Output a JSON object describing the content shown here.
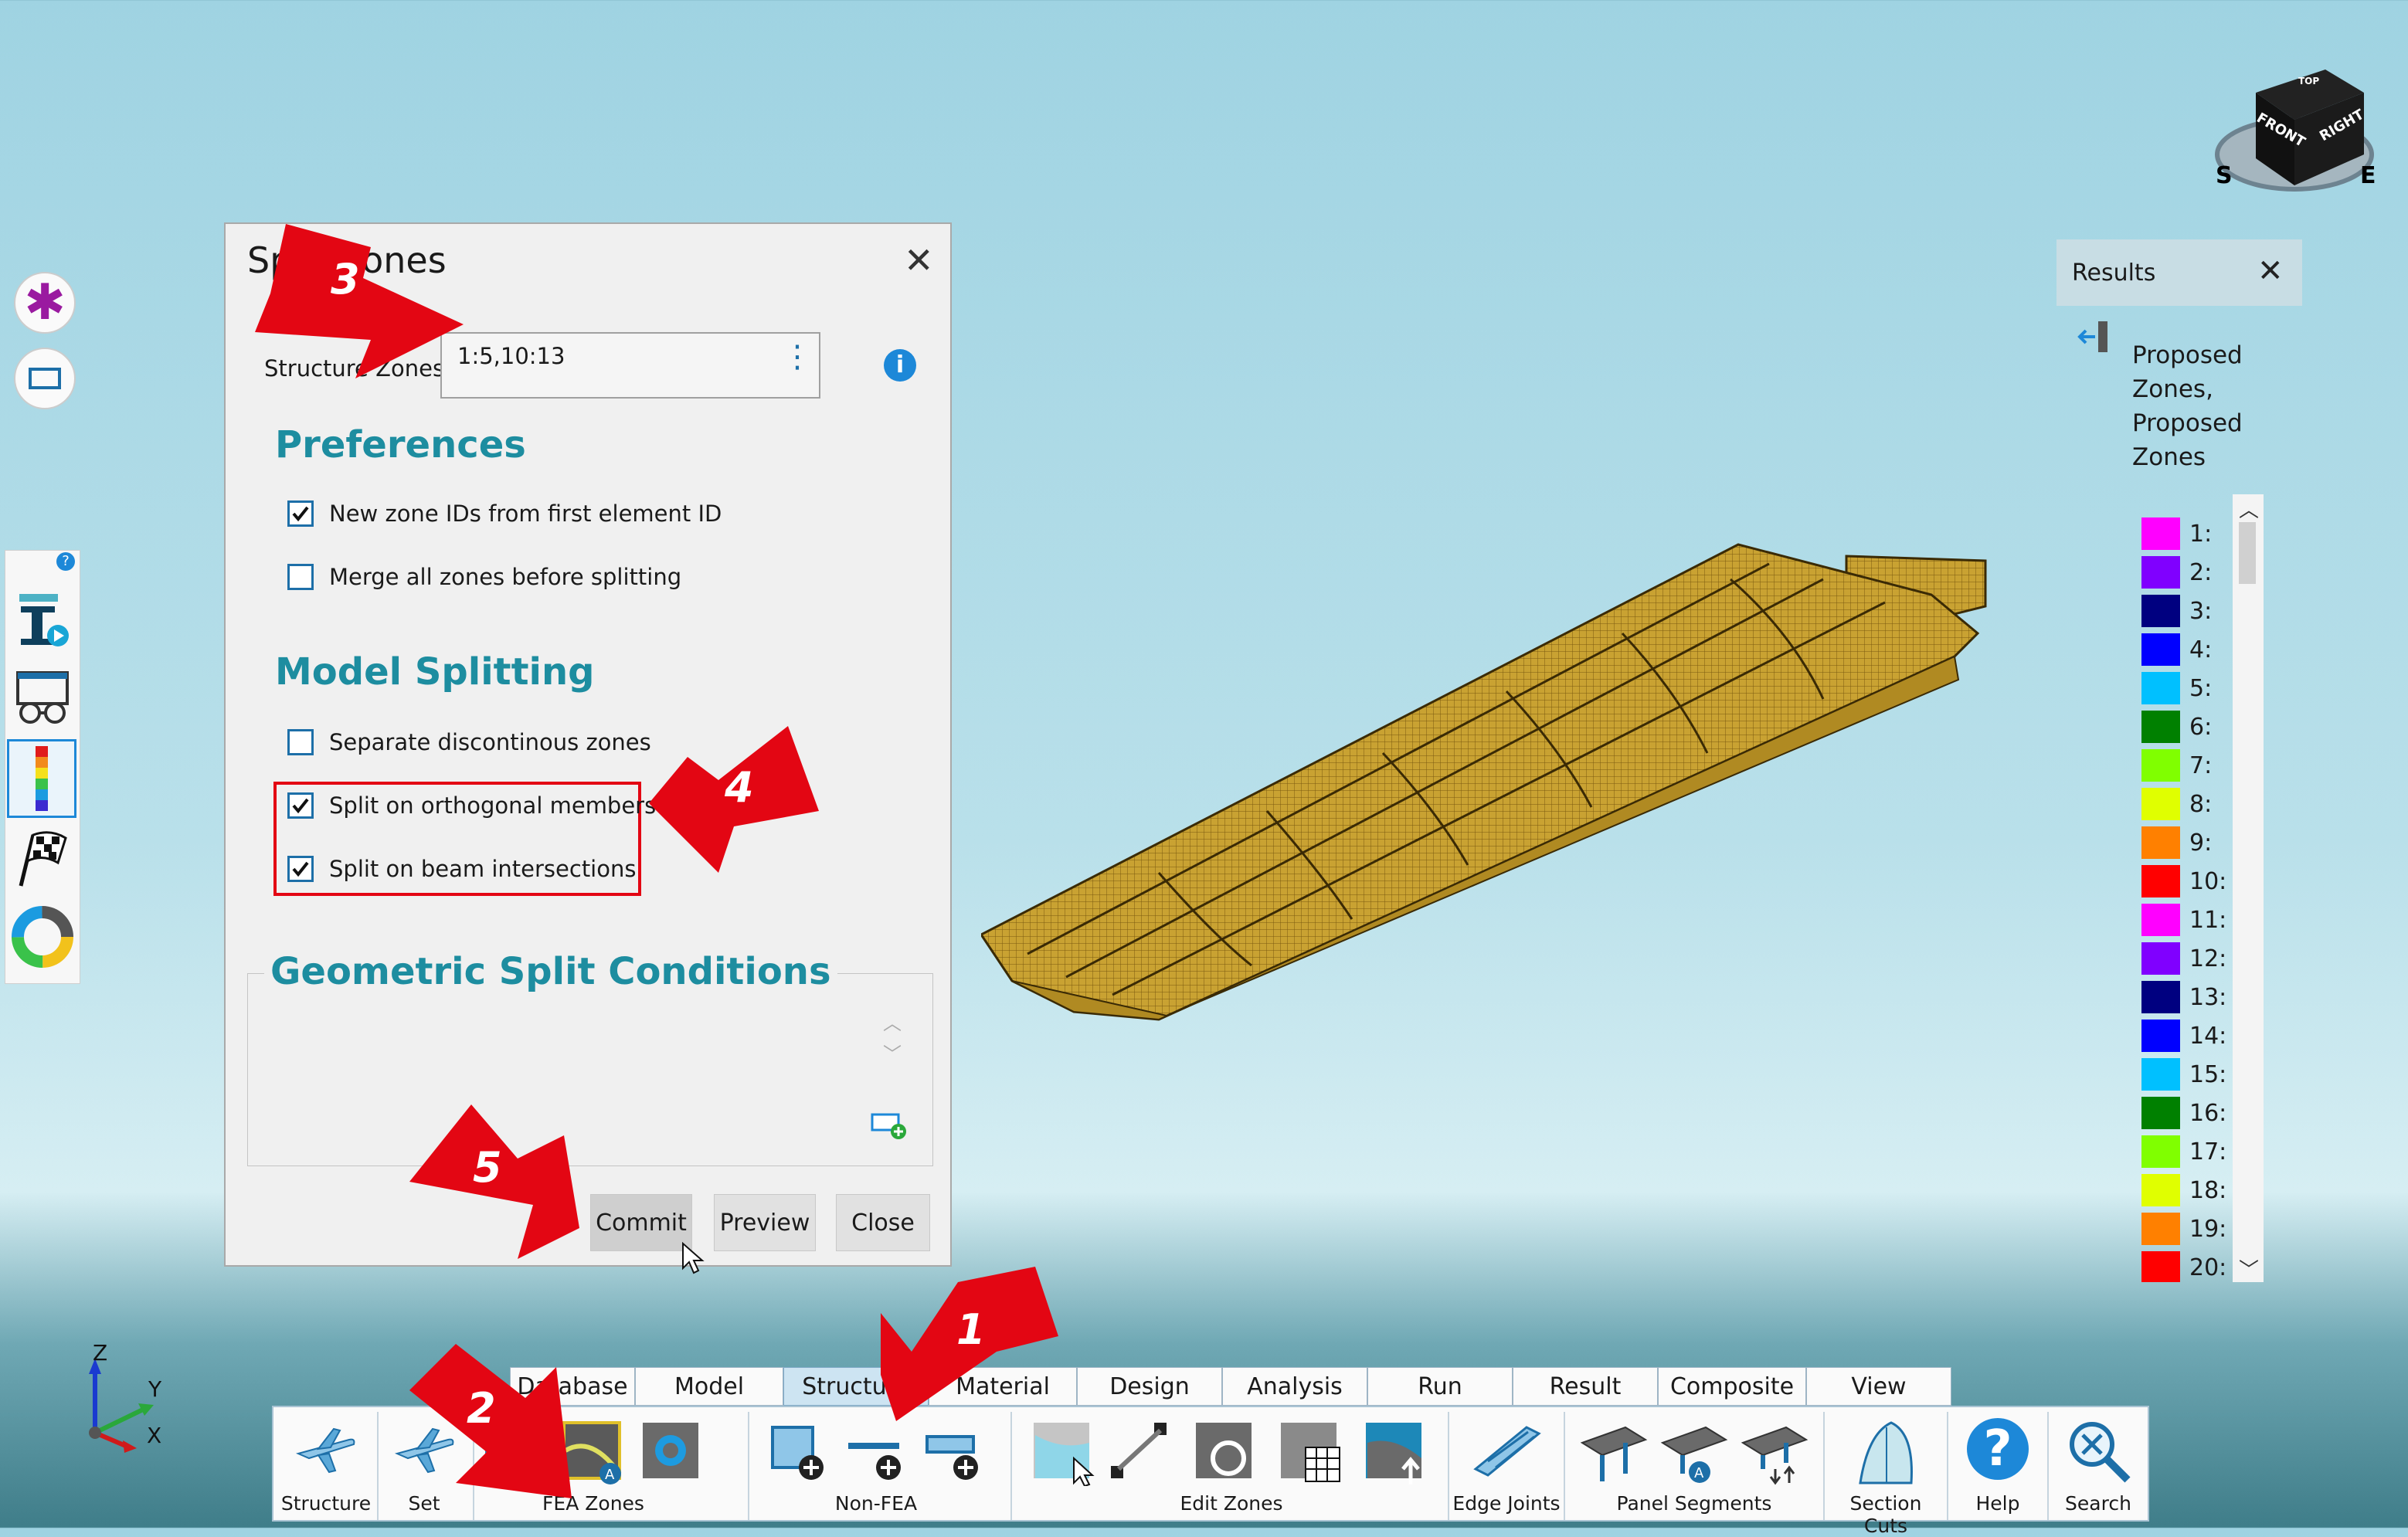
{
  "dialog": {
    "title": "Split Zones",
    "structure_zones_label": "Structure Zones:",
    "structure_zones_value": "1:5,10:13",
    "preferences_header": "Preferences",
    "pref_items": [
      {
        "label": "New zone IDs from first element ID",
        "checked": true
      },
      {
        "label": "Merge all zones before splitting",
        "checked": false
      }
    ],
    "model_splitting_header": "Model Splitting",
    "split_items": [
      {
        "label": "Separate discontinous zones",
        "checked": false
      },
      {
        "label": "Split on orthogonal members",
        "checked": true
      },
      {
        "label": "Split on beam intersections",
        "checked": true
      }
    ],
    "geometric_header": "Geometric Split Conditions",
    "buttons": {
      "commit": "Commit",
      "preview": "Preview",
      "close": "Close"
    }
  },
  "results_panel": {
    "title": "Results",
    "description": "Proposed Zones, Proposed Zones",
    "legend": [
      {
        "label": "1:",
        "color": "#ff00ff"
      },
      {
        "label": "2:",
        "color": "#8000ff"
      },
      {
        "label": "3:",
        "color": "#000080"
      },
      {
        "label": "4:",
        "color": "#0000ff"
      },
      {
        "label": "5:",
        "color": "#00c0ff"
      },
      {
        "label": "6:",
        "color": "#008000"
      },
      {
        "label": "7:",
        "color": "#80ff00"
      },
      {
        "label": "8:",
        "color": "#e0ff00"
      },
      {
        "label": "9:",
        "color": "#ff8000"
      },
      {
        "label": "10:",
        "color": "#ff0000"
      },
      {
        "label": "11:",
        "color": "#ff00ff"
      },
      {
        "label": "12:",
        "color": "#8000ff"
      },
      {
        "label": "13:",
        "color": "#000080"
      },
      {
        "label": "14:",
        "color": "#0000ff"
      },
      {
        "label": "15:",
        "color": "#00c0ff"
      },
      {
        "label": "16:",
        "color": "#008000"
      },
      {
        "label": "17:",
        "color": "#80ff00"
      },
      {
        "label": "18:",
        "color": "#e0ff00"
      },
      {
        "label": "19:",
        "color": "#ff8000"
      },
      {
        "label": "20:",
        "color": "#ff0000"
      }
    ]
  },
  "ribbon": {
    "tabs": [
      {
        "label": "Database",
        "active": false
      },
      {
        "label": "Model",
        "active": false
      },
      {
        "label": "Structure",
        "active": true
      },
      {
        "label": "Material",
        "active": false
      },
      {
        "label": "Design",
        "active": false
      },
      {
        "label": "Analysis",
        "active": false
      },
      {
        "label": "Run",
        "active": false
      },
      {
        "label": "Result",
        "active": false
      },
      {
        "label": "Composite",
        "active": false
      },
      {
        "label": "View",
        "active": false
      }
    ],
    "groups": {
      "structure": "Structure",
      "set": "Set",
      "fea_zones": "FEA Zones",
      "non_fea": "Non-FEA",
      "edit_zones": "Edit Zones",
      "edge_joints": "Edge Joints",
      "panel_segments": "Panel Segments",
      "section_cuts": "Section Cuts",
      "help": "Help",
      "search": "Search"
    }
  },
  "view_cube": {
    "front": "FRONT",
    "right": "RIGHT",
    "top": "TOP",
    "compass_s": "S",
    "compass_e": "E"
  },
  "axes": {
    "z": "Z",
    "y": "Y",
    "x": "X"
  },
  "callouts": [
    "1",
    "2",
    "3",
    "4",
    "5"
  ],
  "colors": {
    "accent": "#1d8da0",
    "callout": "#e30613",
    "mesh": "#c9a232"
  }
}
